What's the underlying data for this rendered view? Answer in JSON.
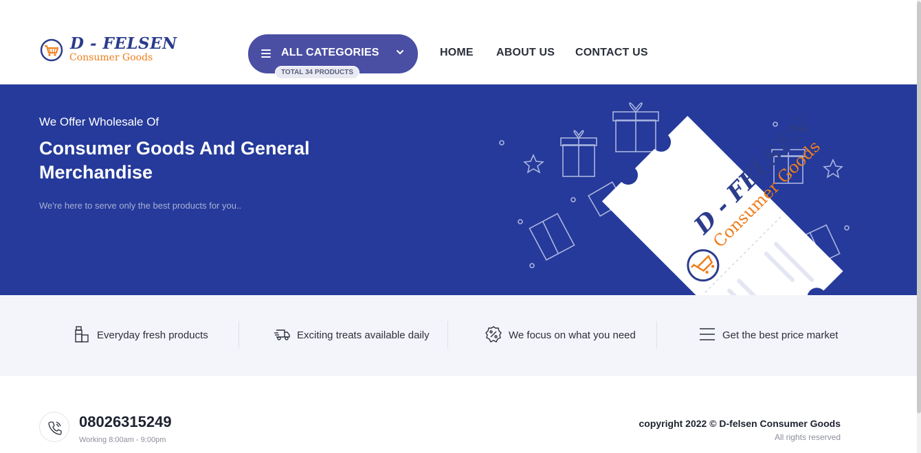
{
  "brand": {
    "title": "D - FELSEN",
    "subtitle": "Consumer Goods",
    "primary_color": "#2b3c8c",
    "accent_color": "#ef7d1a"
  },
  "categories": {
    "label": "ALL CATEGORIES",
    "badge": "TOTAL 34 PRODUCTS",
    "icon": "menu-icon",
    "chevron_icon": "chevron-down-icon",
    "button_color": "#4a4fa3"
  },
  "nav": {
    "items": [
      {
        "label": "HOME"
      },
      {
        "label": "ABOUT US"
      },
      {
        "label": "CONTACT US"
      }
    ]
  },
  "hero": {
    "kicker": "We Offer Wholesale Of",
    "title": "Consumer Goods And General Merchandise",
    "subtitle": "We're here to serve only the best products for you..",
    "background_color": "#253a9a",
    "ticket_brand_title": "D - FELSEN",
    "ticket_brand_subtitle": "Consumer Goods"
  },
  "features": [
    {
      "label": "Everyday fresh products",
      "icon": "bottle-icon"
    },
    {
      "label": "Exciting treats available daily",
      "icon": "delivery-truck-icon"
    },
    {
      "label": "We focus on what you need",
      "icon": "discount-badge-icon"
    },
    {
      "label": "Get the best price market",
      "icon": "menu-lines-icon"
    }
  ],
  "footer": {
    "phone_icon": "phone-icon",
    "phone": "08026315249",
    "hours": "Working 8:00am - 9:00pm",
    "copyright": "copyright 2022 © D-felsen Consumer Goods",
    "rights": "All rights reserved"
  }
}
